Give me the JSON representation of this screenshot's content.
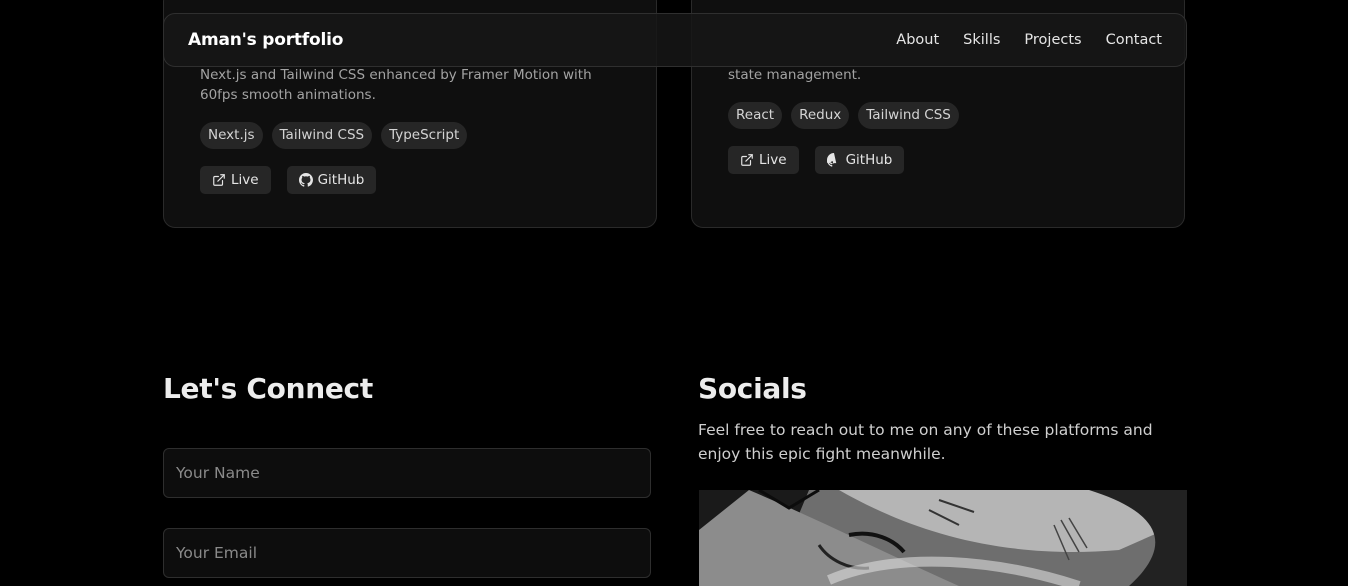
{
  "navbar": {
    "brand": "Aman's portfolio",
    "links": [
      "About",
      "Skills",
      "Projects",
      "Contact"
    ]
  },
  "projects": [
    {
      "description": "Next.js and Tailwind CSS enhanced by Framer Motion with 60fps smooth animations.",
      "tags": [
        "Next.js",
        "Tailwind CSS",
        "TypeScript"
      ],
      "live_label": "Live",
      "github_label": "GitHub"
    },
    {
      "description": "state management.",
      "tags": [
        "React",
        "Redux",
        "Tailwind CSS"
      ],
      "live_label": "Live",
      "github_label": "GitHub"
    }
  ],
  "connect": {
    "title": "Let's Connect",
    "name_placeholder": "Your Name",
    "email_placeholder": "Your Email"
  },
  "socials": {
    "title": "Socials",
    "text": "Feel free to reach out to me on any of these platforms and enjoy this epic fight meanwhile."
  },
  "icons": {
    "live": "external-link-icon",
    "github": "github-icon"
  },
  "colors": {
    "background": "#000000",
    "card": "#0f0f0f",
    "tag": "#262626",
    "text_muted": "#a3a3a3"
  }
}
